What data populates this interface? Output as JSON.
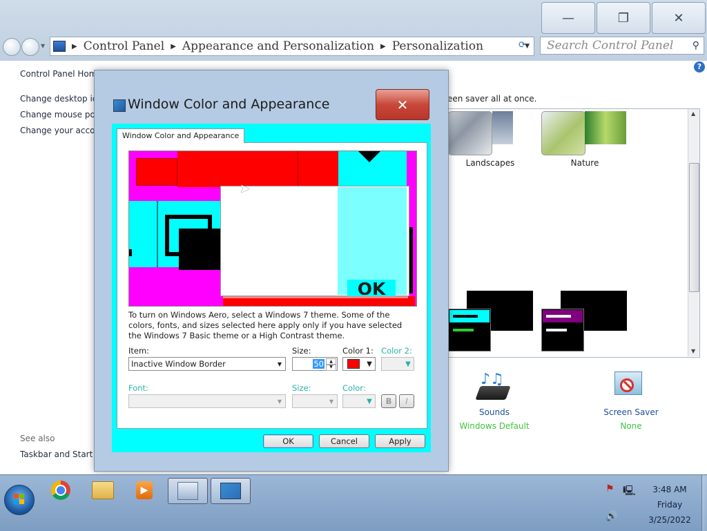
{
  "window": {
    "caption_buttons": {
      "minimize": "—",
      "restore": "❐",
      "close": "✕"
    },
    "breadcrumb": [
      "Control Panel",
      "Appearance and Personalization",
      "Personalization"
    ],
    "search_placeholder": "Search Control Panel"
  },
  "left_pane": {
    "home": "Control Panel Home",
    "links": [
      "Change desktop ico",
      "Change mouse poin",
      "Change your accou"
    ],
    "see_also_title": "See also",
    "see_also_links": [
      "Taskbar and Start M"
    ]
  },
  "main": {
    "screen_saver_text": "een saver all at once.",
    "themes": [
      "Landscapes",
      "Nature"
    ],
    "bottom_items": [
      {
        "title": "Sounds",
        "value": "Windows Default"
      },
      {
        "title": "Screen Saver",
        "value": "None"
      }
    ],
    "value_color": "#3ec43e"
  },
  "dialog": {
    "title": "Window Color and Appearance",
    "close": "✕",
    "tab": "Window Color and Appearance",
    "preview_ok": "OK",
    "description": "To turn on Windows Aero, select a Windows 7 theme.  Some of the colors, fonts, and sizes selected here apply only if you have selected the Windows 7 Basic theme or a High Contrast theme.",
    "item_label": "Item:",
    "item_value": "Inactive Window Border",
    "size_label": "Size:",
    "size_value": "50",
    "color1_label": "Color 1:",
    "color1_value": "#ff0000",
    "color2_label": "Color 2:",
    "font_label": "Font:",
    "font_size_label": "Size:",
    "font_color_label": "Color:",
    "bold": "B",
    "italic": "I",
    "ok": "OK",
    "cancel": "Cancel",
    "apply": "Apply",
    "colors": {
      "frame": "#00ffff",
      "preview_bg": "#ff00ff",
      "active_title": "#ff0000"
    }
  },
  "taskbar": {
    "time": "3:48 AM",
    "day": "Friday",
    "date": "3/25/2022"
  }
}
